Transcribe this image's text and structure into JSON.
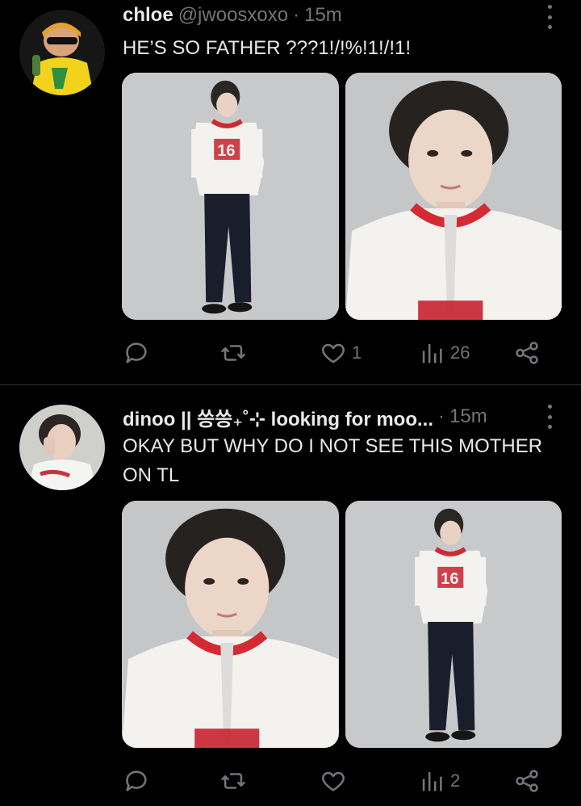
{
  "tweets": [
    {
      "name": "chloe",
      "handle": "@jwoosxoxo",
      "separator": "·",
      "time": "15m",
      "text": "HE’S SO FATHER ???1!/!%!1!/!1!",
      "media": [
        "full-body-photo",
        "portrait-photo"
      ],
      "actions": {
        "replies": "",
        "retweets": "",
        "likes": "1",
        "views": "26"
      }
    },
    {
      "name": "dinoo || 씅씅₊˚⊹ looking for moo...",
      "handle": "",
      "separator": "·",
      "time": "15m",
      "text": "OKAY BUT WHY DO I NOT SEE THIS MOTHER ON TL",
      "media": [
        "portrait-photo",
        "full-body-photo"
      ],
      "actions": {
        "replies": "",
        "retweets": "",
        "likes": "",
        "views": "2"
      }
    }
  ],
  "icons": [
    "more-icon",
    "reply-icon",
    "retweet-icon",
    "like-icon",
    "views-icon",
    "share-icon"
  ],
  "colors": {
    "background": "#000000",
    "text": "#e7e9ea",
    "secondary": "#71767b",
    "divider": "#2f3336"
  }
}
